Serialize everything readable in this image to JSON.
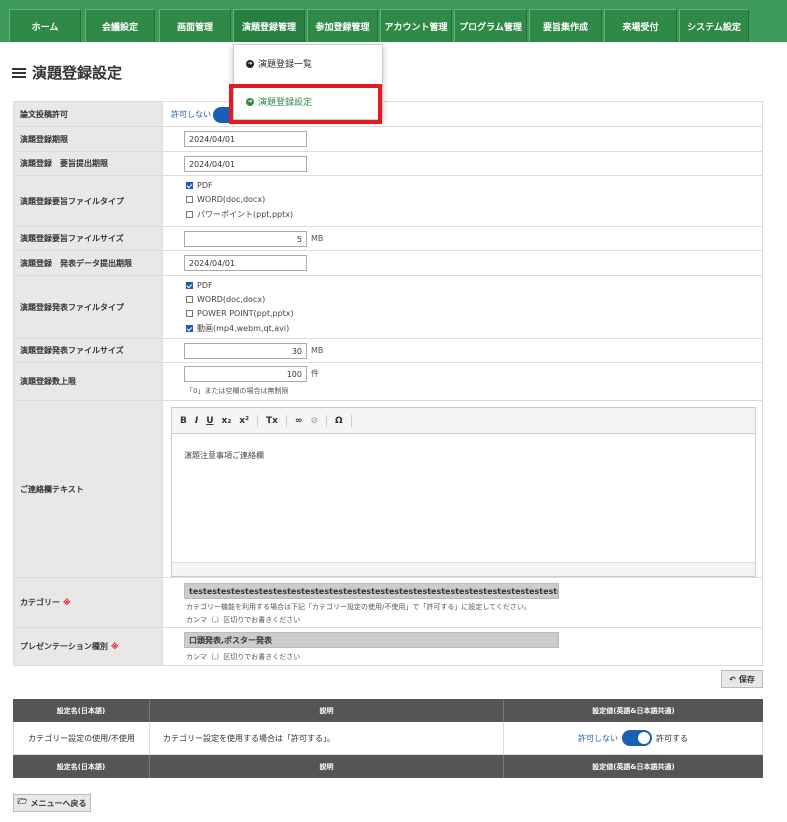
{
  "nav": {
    "items": [
      "ホーム",
      "会議設定",
      "画面管理",
      "演題登録管理",
      "参加登録管理",
      "アカウント管理",
      "プログラム管理",
      "要旨集作成",
      "来場受付",
      "システム設定"
    ]
  },
  "dropdown": {
    "items": [
      "演題登録一覧",
      "演題登録設定"
    ]
  },
  "page_title": "演題登録設定",
  "form": {
    "paper_permission": {
      "label": "論文投稿許可",
      "off_label": "許可しない"
    },
    "reg_period": {
      "label": "演題登録期限",
      "value": "2024/04/01"
    },
    "abstract_deadline": {
      "label": "演題登録　要旨提出期限",
      "value": "2024/04/01"
    },
    "abstract_filetype": {
      "label": "演題登録要旨ファイルタイプ",
      "options": [
        {
          "label": "PDF",
          "checked": true
        },
        {
          "label": "WORD(doc,docx)",
          "checked": false
        },
        {
          "label": "パワーポイント(ppt,pptx)",
          "checked": false
        }
      ]
    },
    "abstract_filesize": {
      "label": "演題登録要旨ファイルサイズ",
      "value": "5",
      "unit": "MB"
    },
    "presentation_deadline": {
      "label": "演題登録　発表データ提出期限",
      "value": "2024/04/01"
    },
    "presentation_filetype": {
      "label": "演題登録発表ファイルタイプ",
      "options": [
        {
          "label": "PDF",
          "checked": true
        },
        {
          "label": "WORD(doc,docx)",
          "checked": false
        },
        {
          "label": "POWER POINT(ppt,pptx)",
          "checked": false
        },
        {
          "label": "動画(mp4,webm,qt,avi)",
          "checked": true
        }
      ]
    },
    "presentation_filesize": {
      "label": "演題登録発表ファイルサイズ",
      "value": "30",
      "unit": "MB"
    },
    "max_count": {
      "label": "演題登録数上限",
      "value": "100",
      "unit": "件",
      "note": "「0」または空欄の場合は無制限"
    },
    "contact_text": {
      "label": "ご連絡欄テキスト",
      "toolbar": [
        "B",
        "I",
        "U",
        "x₂",
        "x²",
        "Tx",
        "∞",
        "⊘",
        "Ω"
      ],
      "body": "演題注意事項ご連絡欄"
    },
    "category": {
      "label": "カテゴリー",
      "required_mark": "※",
      "value": "testestestestestestestestestestestestestestestestestestestestestestestestestestest",
      "note1": "カテゴリー機能を利用する場合は下記「カテゴリー設定の使用/不使用」で「許可する」に設定してください。",
      "note2": "カンマ（,）区切りでお書きください"
    },
    "presentation_type": {
      "label": "プレゼンテーション種別",
      "required_mark": "※",
      "value": "口頭発表,ポスター発表",
      "note": "カンマ（,）区切りでお書きください"
    }
  },
  "save_button": "保存",
  "settings_table": {
    "headers": [
      "設定名(日本語)",
      "説明",
      "設定値(英語&日本語共通)"
    ],
    "rows": [
      {
        "name": "カテゴリー設定の使用/不使用",
        "desc": "カテゴリー設定を使用する場合は「許可する」。",
        "off": "許可しない",
        "on": "許可する"
      }
    ]
  },
  "back_button": "メニューへ戻る",
  "colors": {
    "nav": "#3e9a5a",
    "accent": "#1a5fb4",
    "highlight": "#e01b24"
  }
}
